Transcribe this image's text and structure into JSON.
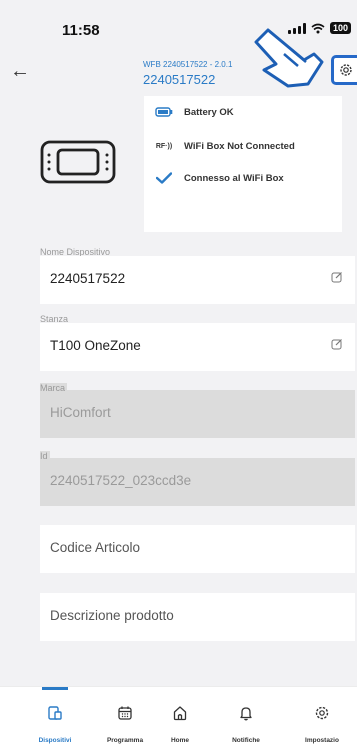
{
  "status_bar": {
    "time": "11:58",
    "battery": "100"
  },
  "header": {
    "subtitle": "WFB 2240517522 - 2.0.1",
    "title": "2240517522",
    "back_icon": "arrow-left-icon",
    "settings_icon": "gear-icon"
  },
  "status_popup": {
    "items": [
      {
        "icon": "battery-icon",
        "label": "Battery OK"
      },
      {
        "icon": "rf-signal-icon",
        "icon_text": "RF·))",
        "label": "WiFi Box Not Connected"
      },
      {
        "icon": "check-icon",
        "label": "Connesso al WiFi Box"
      }
    ]
  },
  "fields": {
    "nome": {
      "label": "Nome Dispositivo",
      "value": "2240517522"
    },
    "stanza": {
      "label": "Stanza",
      "value": "T100 OneZone"
    },
    "marca": {
      "label": "Marca",
      "value": "HiComfort"
    },
    "id": {
      "label": "Id",
      "value": "2240517522_023ccd3e"
    },
    "codice": {
      "placeholder": "Codice Articolo"
    },
    "descrizione": {
      "placeholder": "Descrizione prodotto"
    }
  },
  "nav": {
    "dispositivi": "Dispositivi",
    "programma": "Programma",
    "home": "Home",
    "notifiche": "Notifiche",
    "impostazioni": "Impostazio"
  },
  "colors": {
    "accent": "#2a7bc6",
    "highlight_border": "#2669c8",
    "disabled_field": "#dcdcdc",
    "background": "#f2f2f4"
  }
}
